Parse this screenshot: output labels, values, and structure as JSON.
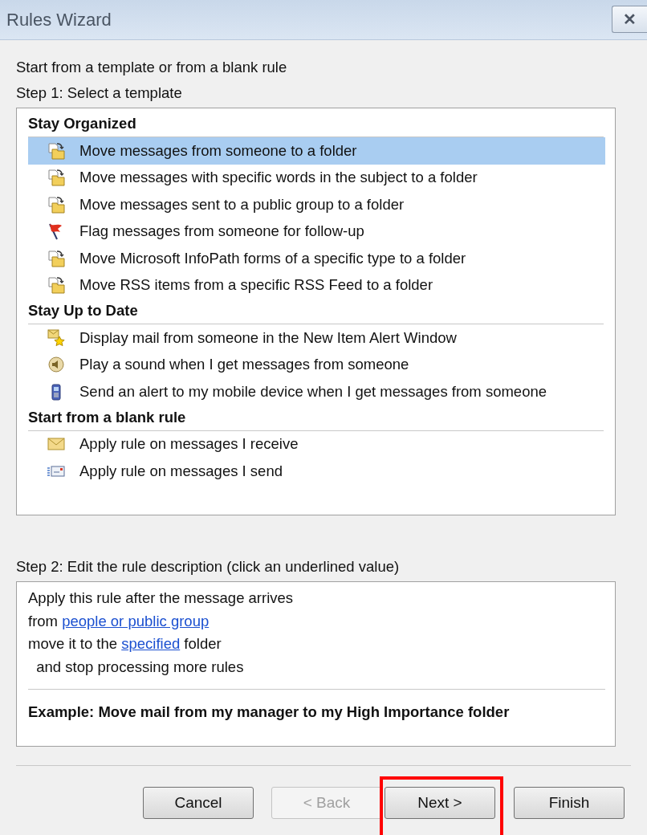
{
  "window": {
    "title": "Rules Wizard",
    "close": "✕"
  },
  "intro": "Start from a template or from a blank rule",
  "step1": "Step 1: Select a template",
  "groups": [
    {
      "title": "Stay Organized",
      "items": [
        {
          "kind": "move",
          "label": "Move messages from someone to a folder",
          "selected": true
        },
        {
          "kind": "move",
          "label": "Move messages with specific words in the subject to a folder",
          "selected": false
        },
        {
          "kind": "move",
          "label": "Move messages sent to a public group to a folder",
          "selected": false
        },
        {
          "kind": "flag",
          "label": "Flag messages from someone for follow-up",
          "selected": false
        },
        {
          "kind": "move",
          "label": "Move Microsoft InfoPath forms of a specific type to a folder",
          "selected": false
        },
        {
          "kind": "move",
          "label": "Move RSS items from a specific RSS Feed to a folder",
          "selected": false
        }
      ]
    },
    {
      "title": "Stay Up to Date",
      "items": [
        {
          "kind": "alert",
          "label": "Display mail from someone in the New Item Alert Window",
          "selected": false
        },
        {
          "kind": "sound",
          "label": "Play a sound when I get messages from someone",
          "selected": false
        },
        {
          "kind": "mobile",
          "label": "Send an alert to my mobile device when I get messages from someone",
          "selected": false
        }
      ]
    },
    {
      "title": "Start from a blank rule",
      "items": [
        {
          "kind": "receive",
          "label": "Apply rule on messages I receive",
          "selected": false
        },
        {
          "kind": "send",
          "label": "Apply rule on messages I send",
          "selected": false
        }
      ]
    }
  ],
  "step2": "Step 2: Edit the rule description (click an underlined value)",
  "description": {
    "lines": [
      {
        "parts": [
          {
            "text": "Apply this rule after the message arrives",
            "link": false
          }
        ]
      },
      {
        "parts": [
          {
            "text": "from ",
            "link": false
          },
          {
            "text": "people or public group",
            "link": true
          }
        ]
      },
      {
        "parts": [
          {
            "text": "move it to the ",
            "link": false
          },
          {
            "text": "specified",
            "link": true
          },
          {
            "text": " folder",
            "link": false
          }
        ]
      },
      {
        "parts": [
          {
            "text": "  and stop processing more rules",
            "link": false
          }
        ]
      }
    ],
    "example": "Example: Move mail from my manager to my High Importance folder"
  },
  "buttons": [
    {
      "label": "Cancel",
      "disabled": false,
      "highlighted": false
    },
    {
      "label": "< Back",
      "disabled": true,
      "highlighted": false
    },
    {
      "label": "Next >",
      "disabled": false,
      "highlighted": true
    },
    {
      "label": "Finish",
      "disabled": false,
      "highlighted": false
    }
  ]
}
